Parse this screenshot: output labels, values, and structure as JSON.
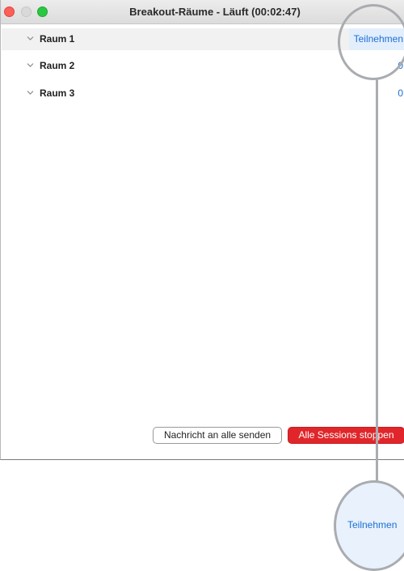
{
  "window": {
    "title": "Breakout-Räume - Läuft (00:02:47)"
  },
  "rooms": [
    {
      "label": "Raum 1",
      "action": "Teilnehmen"
    },
    {
      "label": "Raum 2",
      "count": "0"
    },
    {
      "label": "Raum 3",
      "count": "0"
    }
  ],
  "footer": {
    "send_label": "Nachricht an alle senden",
    "stop_label": "Alle Sessions stoppen"
  },
  "callout": {
    "label": "Teilnehmen"
  },
  "colors": {
    "accent_blue": "#1a6fd6",
    "stop_red": "#e0262a",
    "selected_row": "#f1f1f1"
  }
}
